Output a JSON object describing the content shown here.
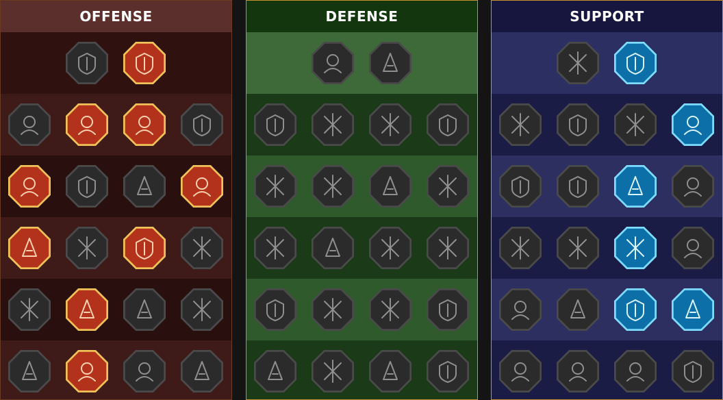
{
  "colors": {
    "inactive_fill": "#2b2b2b",
    "inactive_stroke": "#4a4a4a",
    "inactive_glyph": "#8f8f8f",
    "offense_active_fill": "#b3321b",
    "offense_active_stroke": "#f0c25a",
    "offense_active_glyph": "#ffd0b0",
    "support_active_fill": "#0d6fa8",
    "support_active_stroke": "#7fdcff",
    "support_active_glyph": "#d8f4ff"
  },
  "panels": [
    {
      "id": "offense",
      "title": "OFFENSE",
      "rows": [
        [
          {
            "icon": "crossed-swords-icon",
            "active": false
          },
          {
            "icon": "claw-slash-icon",
            "active": true
          }
        ],
        [
          {
            "icon": "horned-demon-icon",
            "active": false
          },
          {
            "icon": "arrow-strike-icon",
            "active": true
          },
          {
            "icon": "shield-break-icon",
            "active": true
          },
          {
            "icon": "bleeding-heart-icon",
            "active": false
          }
        ],
        [
          {
            "icon": "arrow-pierced-figure-icon",
            "active": true
          },
          {
            "icon": "fanged-maw-icon",
            "active": false
          },
          {
            "icon": "skull-cloak-icon",
            "active": false
          },
          {
            "icon": "slashing-arm-icon",
            "active": true
          }
        ],
        [
          {
            "icon": "dripping-dagger-icon",
            "active": false,
            "active_variant": true
          },
          {
            "icon": "gauntlet-fist-icon",
            "active": false
          },
          {
            "icon": "battle-axe-icon",
            "active": true
          },
          {
            "icon": "chained-lightning-icon",
            "active": false
          }
        ],
        [
          {
            "icon": "impaled-skull-icon",
            "active": false
          },
          {
            "icon": "twin-skulls-icon",
            "active": true
          },
          {
            "icon": "sword-in-circle-icon",
            "active": false
          },
          {
            "icon": "lightning-warrior-icon",
            "active": false
          }
        ],
        [
          {
            "icon": "sparkling-sword-icon",
            "active": false
          },
          {
            "icon": "flaming-helm-icon",
            "active": true
          },
          {
            "icon": "horned-beast-icon",
            "active": false
          },
          {
            "icon": "skull-totem-icon",
            "active": false
          }
        ]
      ]
    },
    {
      "id": "defense",
      "title": "DEFENSE",
      "rows": [
        [
          {
            "icon": "plated-armor-icon",
            "active": false
          },
          {
            "icon": "raised-fist-icon",
            "active": false
          }
        ],
        [
          {
            "icon": "chevron-shield-icon",
            "active": false
          },
          {
            "icon": "armored-heart-icon",
            "active": false
          },
          {
            "icon": "golem-icon",
            "active": false
          },
          {
            "icon": "crossed-blades-icon",
            "active": false
          }
        ],
        [
          {
            "icon": "guardian-pair-icon",
            "active": false
          },
          {
            "icon": "knight-shield-icon",
            "active": false
          },
          {
            "icon": "heart-skull-icon",
            "active": false
          },
          {
            "icon": "hooded-figure-icon",
            "active": false
          }
        ],
        [
          {
            "icon": "crowd-icon",
            "active": false
          },
          {
            "icon": "hourglass-burst-icon",
            "active": false
          },
          {
            "icon": "open-palm-icon",
            "active": false
          },
          {
            "icon": "bull-head-icon",
            "active": false
          }
        ],
        [
          {
            "icon": "dashing-figure-icon",
            "active": false
          },
          {
            "icon": "spiked-shield-icon",
            "active": false
          },
          {
            "icon": "radiant-skull-icon",
            "active": false
          },
          {
            "icon": "swirling-blade-icon",
            "active": false
          }
        ],
        [
          {
            "icon": "spiked-guardian-icon",
            "active": false
          },
          {
            "icon": "winged-shield-icon",
            "active": false
          },
          {
            "icon": "bearded-warrior-icon",
            "active": false
          },
          {
            "icon": "flexing-figure-icon",
            "active": false
          }
        ]
      ]
    },
    {
      "id": "support",
      "title": "SUPPORT",
      "rows": [
        [
          {
            "icon": "healing-heart-icon",
            "active": false
          },
          {
            "icon": "arcane-orb-icon",
            "active": true
          }
        ],
        [
          {
            "icon": "praying-hands-icon",
            "active": false
          },
          {
            "icon": "layered-shield-icon",
            "active": false
          },
          {
            "icon": "smoking-skull-icon",
            "active": false
          },
          {
            "icon": "broken-sword-icon",
            "active": true
          }
        ],
        [
          {
            "icon": "glowing-figure-icon",
            "active": false
          },
          {
            "icon": "lightning-bolt-icon",
            "active": false
          },
          {
            "icon": "shattered-lightning-icon",
            "active": true
          },
          {
            "icon": "twin-figures-icon",
            "active": false
          }
        ],
        [
          {
            "icon": "chained-heart-icon",
            "active": false
          },
          {
            "icon": "comet-icon",
            "active": false
          },
          {
            "icon": "open-book-icon",
            "active": true
          },
          {
            "icon": "glaring-eyes-icon",
            "active": false
          }
        ],
        [
          {
            "icon": "compass-star-icon",
            "active": false
          },
          {
            "icon": "winged-boot-icon",
            "active": false
          },
          {
            "icon": "all-seeing-eye-icon",
            "active": true
          },
          {
            "icon": "voodoo-doll-icon",
            "active": true
          }
        ],
        [
          {
            "icon": "poison-flask-icon",
            "active": false
          },
          {
            "icon": "horned-skull-icon",
            "active": false
          },
          {
            "icon": "crowned-fist-icon",
            "active": false
          },
          {
            "icon": "eagle-head-icon",
            "active": false
          }
        ]
      ]
    }
  ]
}
